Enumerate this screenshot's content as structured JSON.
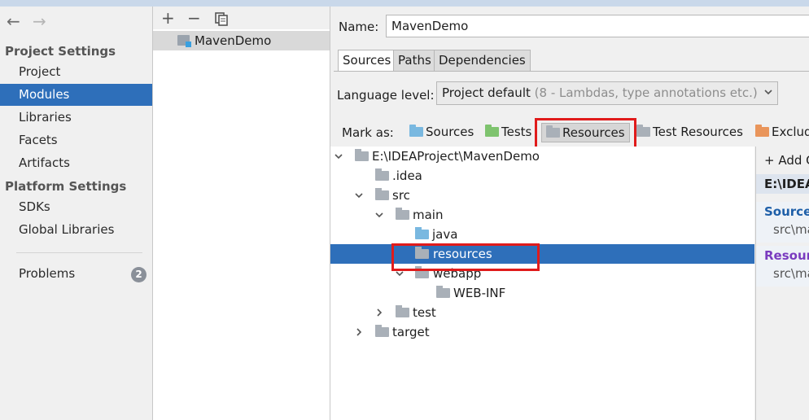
{
  "nav": {
    "back_icon": "arrow-left-icon",
    "forward_icon": "arrow-right-icon"
  },
  "sidebar": {
    "project_settings_heading": "Project Settings",
    "project_items": [
      {
        "label": "Project"
      },
      {
        "label": "Modules",
        "selected": true
      },
      {
        "label": "Libraries"
      },
      {
        "label": "Facets"
      },
      {
        "label": "Artifacts"
      }
    ],
    "platform_settings_heading": "Platform Settings",
    "platform_items": [
      {
        "label": "SDKs"
      },
      {
        "label": "Global Libraries"
      }
    ],
    "problems": {
      "label": "Problems",
      "count": "2"
    }
  },
  "modules": {
    "toolbar": {
      "add": "+",
      "remove": "−",
      "copy_icon": "copy-icon"
    },
    "items": [
      {
        "label": "MavenDemo"
      }
    ]
  },
  "module": {
    "name_label": "Name:",
    "name_value": "MavenDemo",
    "tabs": [
      {
        "label": "Sources",
        "active": true
      },
      {
        "label": "Paths"
      },
      {
        "label": "Dependencies"
      }
    ],
    "language_level_label": "Language level:",
    "language_level_value": "Project default",
    "language_level_hint": "(8 - Lambdas, type annotations etc.)",
    "mark_as_label": "Mark as:",
    "mark_as_buttons": [
      {
        "label": "Sources",
        "color": "#79b8e0"
      },
      {
        "label": "Tests",
        "color": "#7ec36e"
      },
      {
        "label": "Resources",
        "color": "#a9b0b8",
        "pressed": true
      },
      {
        "label": "Test Resources",
        "color": "#a9b0b8"
      },
      {
        "label": "Excluded",
        "color": "#e9955b"
      }
    ]
  },
  "tree": {
    "root": "E:\\IDEAProject\\MavenDemo",
    "idea": ".idea",
    "src": "src",
    "main": "main",
    "java": "java",
    "resources": "resources",
    "webapp": "webapp",
    "webinf": "WEB-INF",
    "test": "test",
    "target": "target"
  },
  "info": {
    "add_label": "Add Content Root",
    "root_header": "E:\\IDEAProject\\MavenDemo",
    "source_heading": "Source Folders",
    "source_path": "src\\main\\java",
    "resource_heading": "Resource Folders",
    "resource_path": "src\\main\\resources"
  },
  "colors": {
    "selection": "#2e6fba",
    "highlight_box": "#e01b1b",
    "resource_heading": "#7a3bbf",
    "source_heading": "#1e5fa8"
  }
}
